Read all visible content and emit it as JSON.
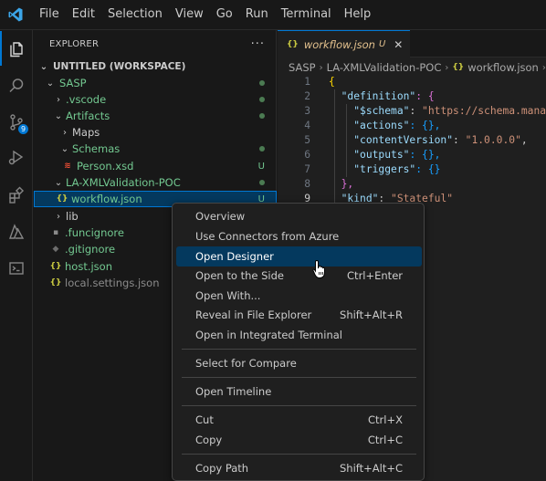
{
  "menubar": [
    "File",
    "Edit",
    "Selection",
    "View",
    "Go",
    "Run",
    "Terminal",
    "Help"
  ],
  "activity": {
    "scm_badge": "9"
  },
  "explorer": {
    "title": "EXPLORER",
    "more": "···",
    "workspace": "UNTITLED (WORKSPACE)",
    "items": [
      {
        "label": "SASP"
      },
      {
        "label": ".vscode"
      },
      {
        "label": "Artifacts"
      },
      {
        "label": "Maps"
      },
      {
        "label": "Schemas"
      },
      {
        "label": "Person.xsd",
        "status": "U"
      },
      {
        "label": "LA-XMLValidation-POC"
      },
      {
        "label": "workflow.json",
        "status": "U"
      },
      {
        "label": "lib"
      },
      {
        "label": ".funcignore"
      },
      {
        "label": ".gitignore"
      },
      {
        "label": "host.json"
      },
      {
        "label": "local.settings.json"
      }
    ]
  },
  "tab": {
    "name": "workflow.json",
    "status": "U",
    "close": "✕"
  },
  "breadcrumb": {
    "p1": "SASP",
    "p2": "LA-XMLValidation-POC",
    "p3": "workflow.json",
    "p4": "..."
  },
  "code": {
    "l1": "{",
    "l2k": "\"definition\"",
    "l2r": ": {",
    "l3k": "\"$schema\"",
    "l3v": "\"https://schema.manage",
    "l4k": "\"actions\"",
    "l4v": ": {},",
    "l5k": "\"contentVersion\"",
    "l5v": "\"1.0.0.0\"",
    "l6k": "\"outputs\"",
    "l6v": ": {},",
    "l7k": "\"triggers\"",
    "l7v": ": {}",
    "l8": "},",
    "l9k": "\"kind\"",
    "l9v": "\"Stateful\""
  },
  "context_menu": {
    "overview": "Overview",
    "connectors": "Use Connectors from Azure",
    "open_designer": "Open Designer",
    "open_side": "Open to the Side",
    "open_side_kb": "Ctrl+Enter",
    "open_with": "Open With...",
    "reveal": "Reveal in File Explorer",
    "reveal_kb": "Shift+Alt+R",
    "open_terminal": "Open in Integrated Terminal",
    "select_compare": "Select for Compare",
    "timeline": "Open Timeline",
    "cut": "Cut",
    "cut_kb": "Ctrl+X",
    "copy": "Copy",
    "copy_kb": "Ctrl+C",
    "copy_path": "Copy Path",
    "copy_path_kb": "Shift+Alt+C"
  },
  "colors": {
    "accent": "#0078d4",
    "selection": "#04395e",
    "untracked": "#73c991"
  }
}
